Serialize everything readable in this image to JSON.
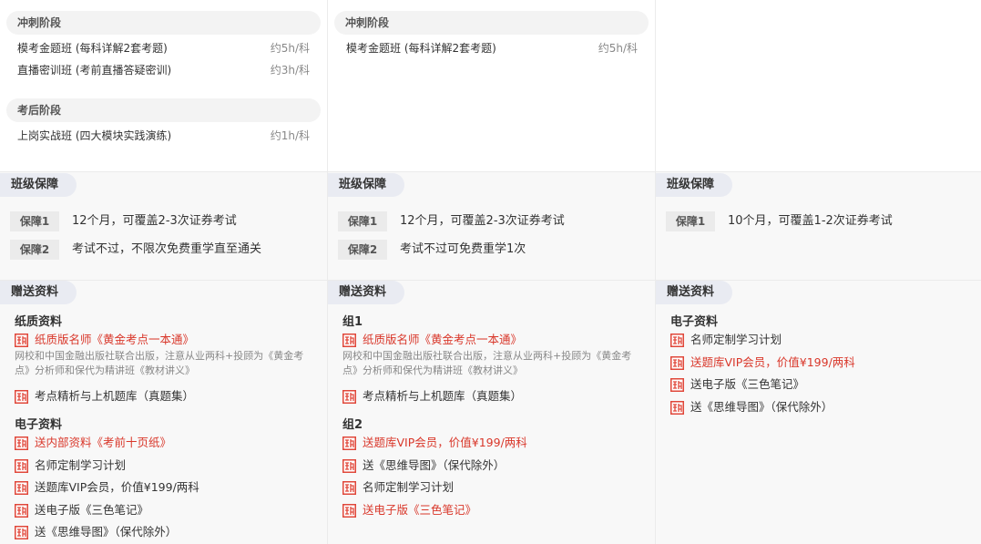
{
  "col1": {
    "stages": [
      {
        "title": "冲刺阶段",
        "rows": [
          {
            "name": "模考金题班 (每科详解2套考题)",
            "dur": "约5h/科"
          },
          {
            "name": "直播密训班 (考前直播答疑密训)",
            "dur": "约3h/科"
          }
        ]
      },
      {
        "title": "考后阶段",
        "rows": [
          {
            "name": "上岗实战班 (四大模块实践演练)",
            "dur": "约1h/科"
          }
        ]
      }
    ],
    "guarantee_title": "班级保障",
    "guarantees": [
      {
        "badge": "保障1",
        "text": "12个月，可覆盖2-3次证券考试"
      },
      {
        "badge": "保障2",
        "text": "考试不过，不限次免费重学直至通关"
      }
    ],
    "gift_title": "赠送资料",
    "paper_title": "纸质资料",
    "paper_item": "纸质版名师《黄金考点一本通》",
    "paper_desc": "网校和中国金融出版社联合出版，注意从业两科+投顾为《黄金考点》分析师和保代为精讲班《教材讲义》",
    "paper_item2": "考点精析与上机题库（真题集）",
    "e_title": "电子资料",
    "e_items": [
      {
        "text": "送内部资料《考前十页纸》",
        "red": true
      },
      {
        "text": "名师定制学习计划",
        "red": false
      },
      {
        "text": "送题库VIP会员，价值¥199/两科",
        "red": false
      },
      {
        "text": "送电子版《三色笔记》",
        "red": false
      },
      {
        "text": "送《思维导图》（保代除外）",
        "red": false
      }
    ]
  },
  "col2": {
    "stages": [
      {
        "title": "冲刺阶段",
        "rows": [
          {
            "name": "模考金题班 (每科详解2套考题)",
            "dur": "约5h/科"
          }
        ]
      }
    ],
    "guarantee_title": "班级保障",
    "guarantees": [
      {
        "badge": "保障1",
        "text": "12个月，可覆盖2-3次证券考试"
      },
      {
        "badge": "保障2",
        "text": "考试不过可免费重学1次"
      }
    ],
    "gift_title": "赠送资料",
    "g1_title": "组1",
    "g1_item": "纸质版名师《黄金考点一本通》",
    "g1_desc": "网校和中国金融出版社联合出版，注意从业两科+投顾为《黄金考点》分析师和保代为精讲班《教材讲义》",
    "g1_item2": "考点精析与上机题库（真题集）",
    "g2_title": "组2",
    "g2_items": [
      {
        "text": "送题库VIP会员，价值¥199/两科",
        "red": true
      },
      {
        "text": "送《思维导图》（保代除外）",
        "red": false
      },
      {
        "text": "名师定制学习计划",
        "red": false
      },
      {
        "text": "送电子版《三色笔记》",
        "red": true
      }
    ]
  },
  "col3": {
    "guarantee_title": "班级保障",
    "guarantees": [
      {
        "badge": "保障1",
        "text": "10个月，可覆盖1-2次证券考试"
      }
    ],
    "gift_title": "赠送资料",
    "e_title": "电子资料",
    "e_items": [
      {
        "text": "名师定制学习计划",
        "red": false
      },
      {
        "text": "送题库VIP会员，价值¥199/两科",
        "red": true
      },
      {
        "text": "送电子版《三色笔记》",
        "red": false
      },
      {
        "text": "送《思维导图》（保代除外）",
        "red": false
      }
    ]
  },
  "icon_name": "gift-stamp-icon",
  "colors": {
    "red": "#d9372a",
    "icon_red": "#e0473a"
  }
}
